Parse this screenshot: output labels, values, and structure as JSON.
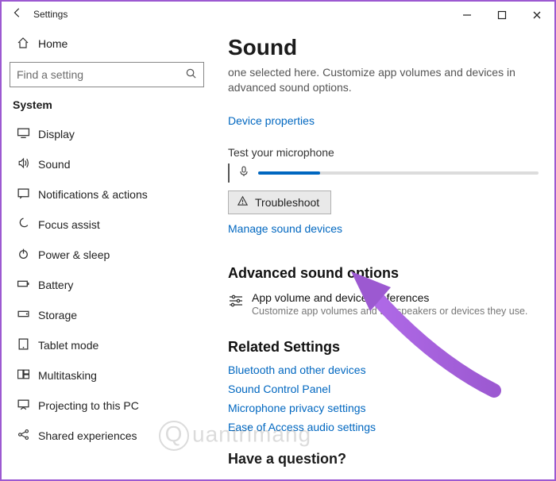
{
  "window": {
    "app_title": "Settings"
  },
  "sidebar": {
    "home_label": "Home",
    "search_placeholder": "Find a setting",
    "group_title": "System",
    "items": [
      {
        "label": "Display",
        "icon": "display-icon"
      },
      {
        "label": "Sound",
        "icon": "sound-icon"
      },
      {
        "label": "Notifications & actions",
        "icon": "notifications-icon"
      },
      {
        "label": "Focus assist",
        "icon": "focus-assist-icon"
      },
      {
        "label": "Power & sleep",
        "icon": "power-icon"
      },
      {
        "label": "Battery",
        "icon": "battery-icon"
      },
      {
        "label": "Storage",
        "icon": "storage-icon"
      },
      {
        "label": "Tablet mode",
        "icon": "tablet-icon"
      },
      {
        "label": "Multitasking",
        "icon": "multitasking-icon"
      },
      {
        "label": "Projecting to this PC",
        "icon": "projecting-icon"
      },
      {
        "label": "Shared experiences",
        "icon": "shared-icon"
      }
    ]
  },
  "main": {
    "page_title": "Sound",
    "intro": "one selected here. Customize app volumes and devices in advanced sound options.",
    "device_properties_link": "Device properties",
    "test_mic_label": "Test your microphone",
    "mic_level_pct": 22,
    "troubleshoot_btn": "Troubleshoot",
    "manage_devices_link": "Manage sound devices",
    "advanced": {
      "heading": "Advanced sound options",
      "item_title": "App volume and device preferences",
      "item_sub": "Customize app volumes and the speakers or devices they use."
    },
    "related": {
      "heading": "Related Settings",
      "links": [
        "Bluetooth and other devices",
        "Sound Control Panel",
        "Microphone privacy settings",
        "Ease of Access audio settings"
      ]
    },
    "question_heading": "Have a question?"
  },
  "watermark": "uantrimang"
}
